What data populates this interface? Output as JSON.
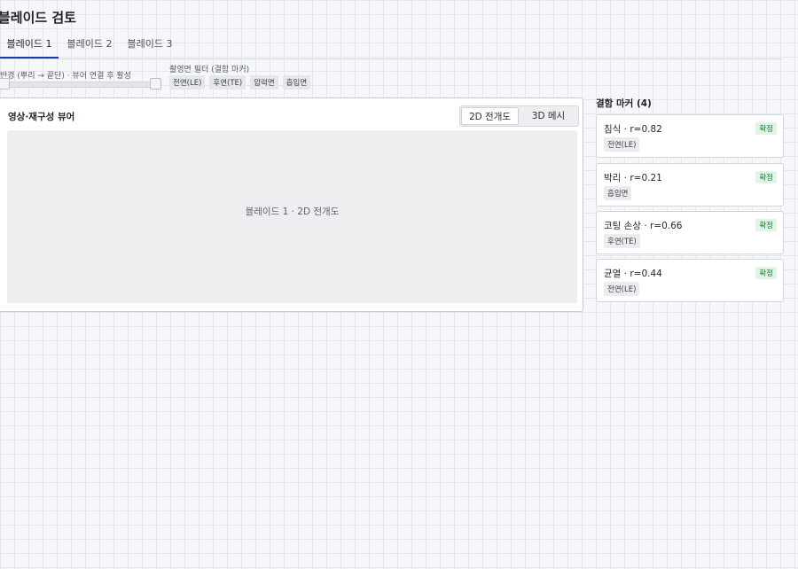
{
  "page": {
    "title": "블레이드 검토"
  },
  "tabs": [
    {
      "label": "블레이드 1"
    },
    {
      "label": "블레이드 2"
    },
    {
      "label": "블레이드 3"
    }
  ],
  "controls": {
    "radius_label": "반경 (뿌리 → 끝단) · 뷰어 연결 후 활성",
    "filter_label": "촬영면 필터 (결함 마커)",
    "filter_chips": [
      "전연(LE)",
      "후연(TE)",
      "압력면",
      "흡입면"
    ]
  },
  "viewer": {
    "title": "영상·재구성 뷰어",
    "modes": [
      "2D 전개도",
      "3D 메시"
    ],
    "active_mode": "2D 전개도",
    "canvas_label": "블레이드 1 · 2D 전개도"
  },
  "markers": {
    "heading": "결함 마커 (4)",
    "items": [
      {
        "name": "침식 · r=0.82",
        "status": "확정",
        "face": "전연(LE)"
      },
      {
        "name": "박리 · r=0.21",
        "status": "확정",
        "face": "흡입면"
      },
      {
        "name": "코팅 손상 · r=0.66",
        "status": "확정",
        "face": "후연(TE)"
      },
      {
        "name": "균열 · r=0.44",
        "status": "확정",
        "face": "전연(LE)"
      }
    ]
  },
  "colors": {
    "accent": "#1f3aa8",
    "confirmed": "#1d7a3c"
  }
}
